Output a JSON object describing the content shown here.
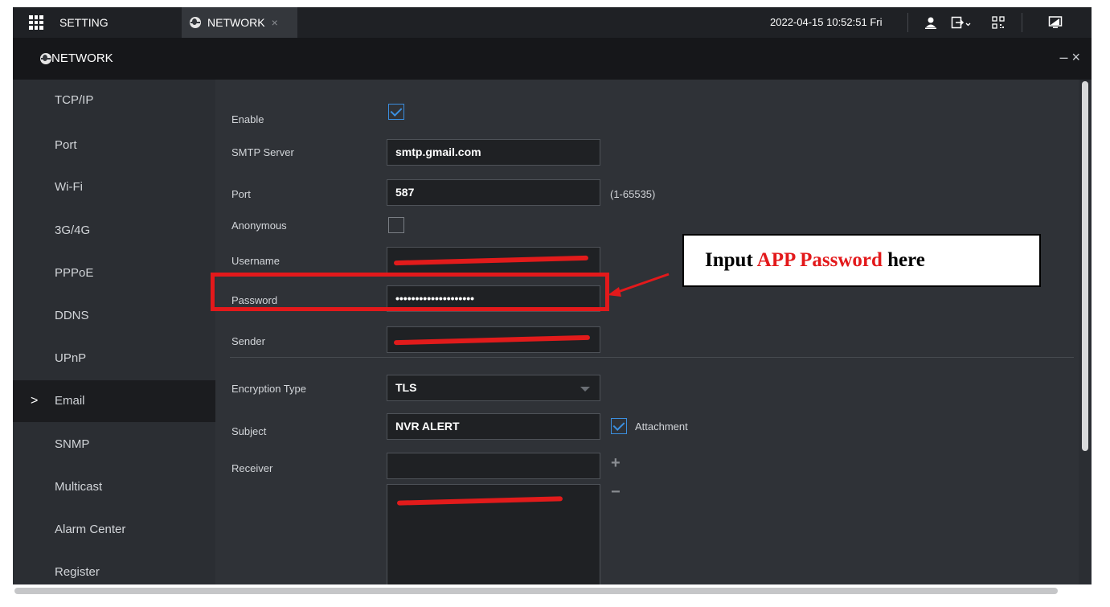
{
  "topbar": {
    "setting_label": "SETTING",
    "tab_label": "NETWORK",
    "tab_close": "×",
    "datetime": "2022-04-15 10:52:51 Fri",
    "icons": [
      "user-icon",
      "logout-icon",
      "qr-code-icon",
      "monitor-icon"
    ]
  },
  "window": {
    "title": "NETWORK",
    "minimize": "–",
    "close": "×"
  },
  "sidebar": {
    "items": [
      {
        "label": "TCP/IP"
      },
      {
        "label": "Port"
      },
      {
        "label": "Wi-Fi"
      },
      {
        "label": "3G/4G"
      },
      {
        "label": "PPPoE"
      },
      {
        "label": "DDNS"
      },
      {
        "label": "UPnP"
      },
      {
        "label": "Email",
        "active": true,
        "arrow": ">"
      },
      {
        "label": "SNMP"
      },
      {
        "label": "Multicast"
      },
      {
        "label": "Alarm Center"
      },
      {
        "label": "Register"
      }
    ]
  },
  "form": {
    "enable_label": "Enable",
    "enable_checked": true,
    "smtp_label": "SMTP Server",
    "smtp_value": "smtp.gmail.com",
    "port_label": "Port",
    "port_value": "587",
    "port_hint": "(1-65535)",
    "anonymous_label": "Anonymous",
    "anonymous_checked": false,
    "username_label": "Username",
    "password_label": "Password",
    "password_value": "••••••••••••••••••••",
    "sender_label": "Sender",
    "encryption_label": "Encryption Type",
    "encryption_value": "TLS",
    "subject_label": "Subject",
    "subject_value": "NVR ALERT",
    "attachment_label": "Attachment",
    "attachment_checked": true,
    "receiver_label": "Receiver",
    "add_symbol": "+",
    "remove_symbol": "−"
  },
  "annotation": {
    "prefix": "Input ",
    "highlight": "APP Password",
    "suffix": " here",
    "highlight_color": "#e3191b"
  },
  "colors": {
    "accent": "#3b8fe0",
    "redaction": "#e21b1b"
  }
}
